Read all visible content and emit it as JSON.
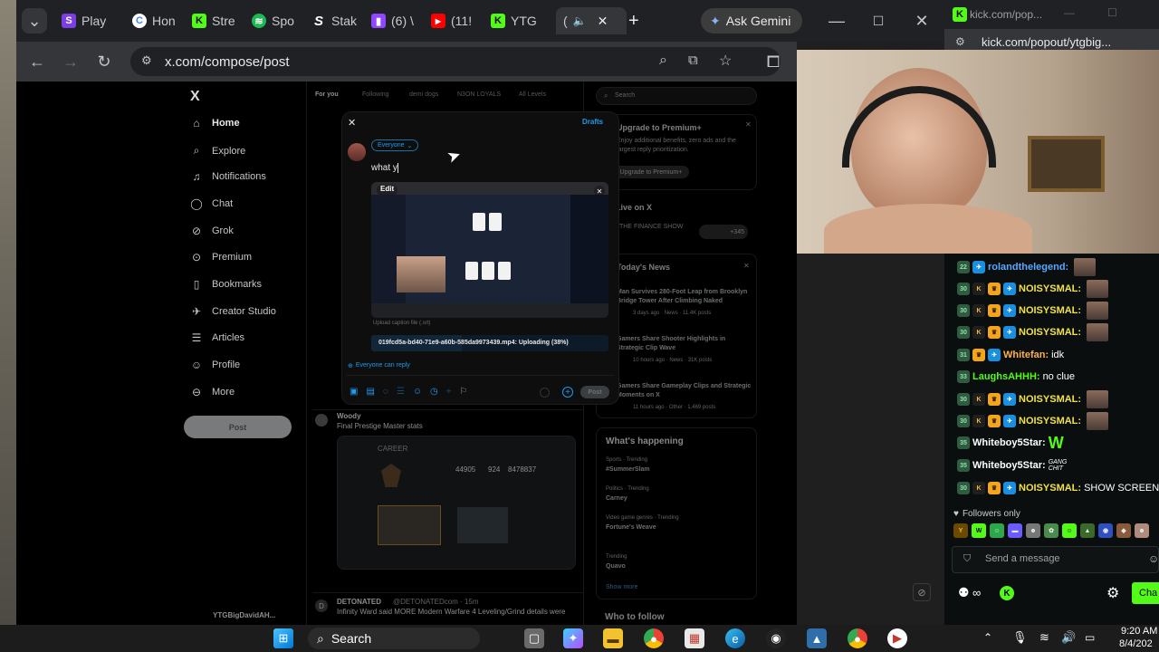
{
  "browser": {
    "tabs": [
      {
        "label": "Play",
        "icon": "twitch-like-icon",
        "color": "#7b3fe4"
      },
      {
        "label": "Hon",
        "icon": "chrome-icon",
        "color": "#4285f4"
      },
      {
        "label": "Stre",
        "icon": "kick-icon",
        "color": "#53fc18"
      },
      {
        "label": "Spo",
        "icon": "spotify-icon",
        "color": "#1db954"
      },
      {
        "label": "Stak",
        "icon": "stake-icon",
        "color": "#ffffff"
      },
      {
        "label": "(6) \\",
        "icon": "twitch-icon",
        "color": "#9146ff"
      },
      {
        "label": "(11!",
        "icon": "youtube-icon",
        "color": "#ff0000"
      },
      {
        "label": "YTG",
        "icon": "kick-icon",
        "color": "#53fc18"
      },
      {
        "label": "(",
        "icon": "audio-icon",
        "color": "#ffffff"
      }
    ],
    "new_tab": "+",
    "gemini_label": "Ask Gemini",
    "url": "x.com/compose/post"
  },
  "x_nav": {
    "logo": "X",
    "items": [
      "Home",
      "Explore",
      "Notifications",
      "Chat",
      "Grok",
      "Premium",
      "Bookmarks",
      "Creator Studio",
      "Articles",
      "Profile",
      "More"
    ],
    "post_button": "Post",
    "account": "YTGBigDavidAH..."
  },
  "feed": {
    "tabs": [
      "For you",
      "Following",
      "demi dogs",
      "N3ON LOYALS",
      "All Levels"
    ],
    "posts": [
      {
        "author": "Woody",
        "text": "Final Prestige Master stats",
        "card_title": "CAREER"
      },
      {
        "author": "DETONATED",
        "handle": "@DETONATEDcom · 15m",
        "text": "Infinity Ward said MORE Modern Warfare 4 Leveling/Grind details were"
      }
    ],
    "stats": [
      "44905",
      "924",
      "8478837"
    ]
  },
  "compose": {
    "close": "✕",
    "drafts": "Drafts",
    "audience": "Everyone",
    "text": "what y",
    "edit_label": "Edit",
    "caption_hint": "Upload caption file (.srt)",
    "upload_status": "019fcd5a-bd40-71e9-a60b-585da9973439.mp4: Uploading (38%)",
    "reply_setting": "Everyone can reply",
    "post_button": "Post",
    "upload_progress": 0.38
  },
  "right_sidebar": {
    "search_placeholder": "Search",
    "premium_title": "Upgrade to Premium+",
    "premium_text": "Enjoy additional benefits, zero ads and the largest reply prioritization.",
    "premium_button": "Upgrade to Premium+",
    "live_title": "Live on X",
    "live_item": "THE FINANCE SHOW",
    "live_count": "+345",
    "news_title": "Today's News",
    "news": [
      {
        "title": "Man Survives 280-Foot Leap from Brooklyn Bridge Tower After Climbing Naked",
        "meta": "3 days ago · News · 11.4K posts"
      },
      {
        "title": "Gamers Share Shooter Highlights in Strategic Clip Wave",
        "meta": "10 hours ago · News · 31K posts"
      },
      {
        "title": "Gamers Share Gameplay Clips and Strategic Moments on X",
        "meta": "11 hours ago · Other · 1,469 posts"
      }
    ],
    "happening_title": "What's happening",
    "trends": [
      {
        "context": "Sports · Trending",
        "name": "#SummerSlam"
      },
      {
        "context": "Politics · Trending",
        "name": "Carney"
      },
      {
        "context": "Video game genres · Trending",
        "name": "Fortune's Weave"
      },
      {
        "context": "Trending",
        "name": "Quavo"
      }
    ],
    "show_more": "Show more",
    "who_to_follow": "Who to follow"
  },
  "chat": {
    "window_url_top": "kick.com/pop...",
    "window_url": "kick.com/popout/ytgbig...",
    "messages": [
      {
        "num": "22",
        "user": "rolandthelegend:",
        "text": "",
        "color": "#5aa7ff",
        "emote": true
      },
      {
        "num": "30",
        "user": "NOISYSMAL:",
        "text": "",
        "color": "#f0e14a",
        "emote": true
      },
      {
        "num": "30",
        "user": "NOISYSMAL:",
        "text": "",
        "color": "#f0e14a",
        "emote": true
      },
      {
        "num": "30",
        "user": "NOISYSMAL:",
        "text": "",
        "color": "#f0e14a",
        "emote": true
      },
      {
        "num": "31",
        "user": "Whitefan:",
        "text": "idk",
        "color": "#ffb347",
        "emote": false
      },
      {
        "num": "33",
        "user": "LaughsAHHH:",
        "text": "no clue",
        "color": "#53fc18",
        "emote": false
      },
      {
        "num": "30",
        "user": "NOISYSMAL:",
        "text": "",
        "color": "#f0e14a",
        "emote": true
      },
      {
        "num": "30",
        "user": "NOISYSMAL:",
        "text": "",
        "color": "#f0e14a",
        "emote": true
      },
      {
        "num": "35",
        "user": "Whiteboy5Star:",
        "text": "W",
        "color": "#ffffff",
        "emote": false
      },
      {
        "num": "35",
        "user": "Whiteboy5Star:",
        "text": "GANG CHIT",
        "color": "#ffffff",
        "emote": false
      },
      {
        "num": "30",
        "user": "NOISYSMAL:",
        "text": "SHOW SCREEN",
        "color": "#f0e14a",
        "emote": false
      }
    ],
    "followers_only": "Followers only",
    "input_placeholder": "Send a message",
    "chat_button": "Cha"
  },
  "taskbar": {
    "search": "Search",
    "time": "9:20 AM",
    "date": "8/4/202"
  },
  "colors": {
    "kick_green": "#53fc18",
    "x_blue": "#1d9bf0",
    "gemini_bg": "#3c3c3c"
  }
}
